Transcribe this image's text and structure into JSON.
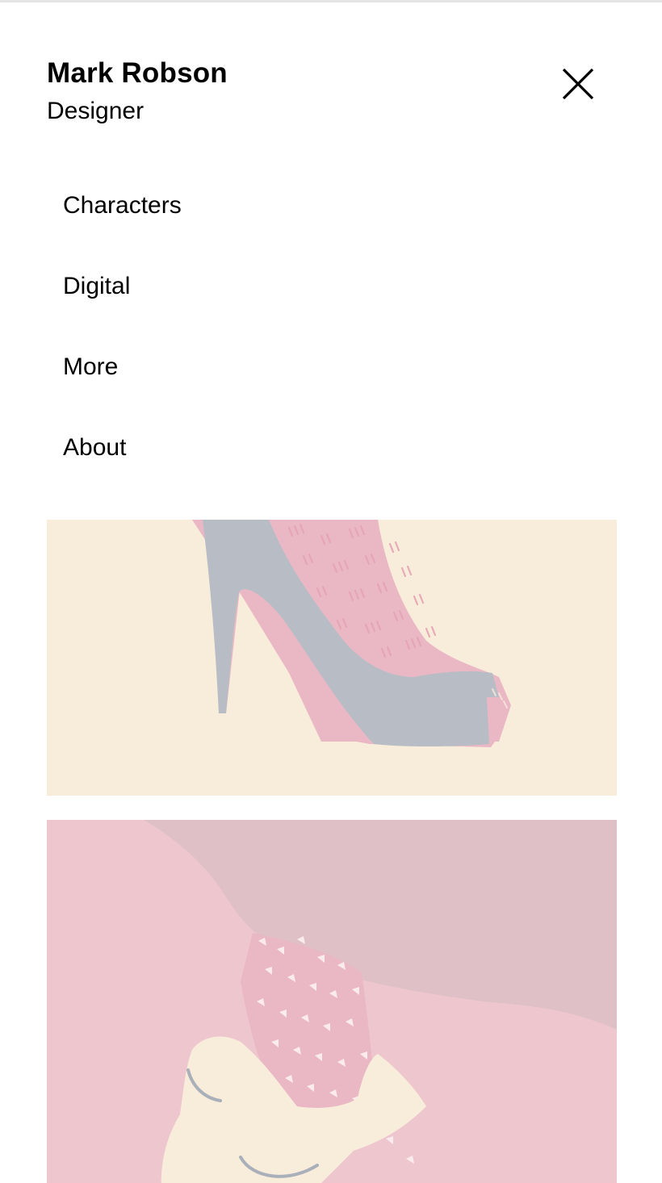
{
  "header": {
    "name": "Mark Robson",
    "role": "Designer",
    "close_icon": "close-icon"
  },
  "nav": {
    "items": [
      {
        "label": "Characters"
      },
      {
        "label": "Digital"
      },
      {
        "label": "More"
      },
      {
        "label": "About"
      }
    ]
  },
  "gallery": {
    "items": [
      {
        "subject": "high-heel-shoe",
        "colors": {
          "bg": "#f8ecdb",
          "shoe": "#b8bdc5",
          "accent": "#eab8c4"
        }
      },
      {
        "subject": "loafer-shoe",
        "colors": {
          "bg": "#eec6ce",
          "shadow": "#dfc0c6",
          "shoe": "#f8ecdb",
          "accent": "#aab0b9"
        }
      }
    ]
  }
}
